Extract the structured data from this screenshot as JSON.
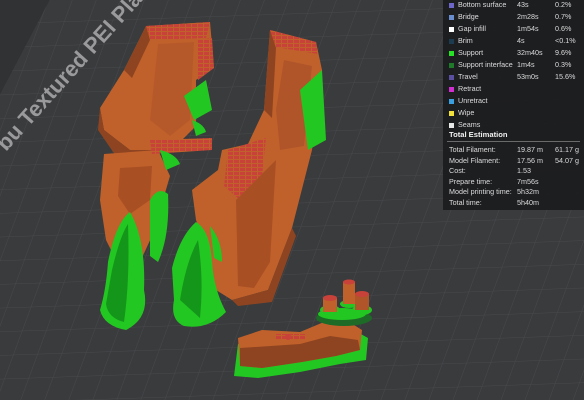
{
  "plate": {
    "label": "bu Textured PEI Plate"
  },
  "colors": {
    "bg": "#2b2c2e",
    "bed": "#3a3b3d",
    "model": "#c0612b",
    "model_dark": "#8e4420",
    "model_light": "#d8783c",
    "support": "#22c722",
    "support_dark": "#14961a",
    "infill_red": "#c8423a"
  },
  "legend": {
    "rows": [
      {
        "label": "Bottom surface",
        "time": "43s",
        "pct": "0.2%",
        "color": "#6e67c9"
      },
      {
        "label": "Bridge",
        "time": "2m28s",
        "pct": "0.7%",
        "color": "#6a8dcf"
      },
      {
        "label": "Gap infill",
        "time": "1m54s",
        "pct": "0.6%",
        "color": "#ffffff"
      },
      {
        "label": "Brim",
        "time": "4s",
        "pct": "<0.1%",
        "color": "#1c3b4e"
      },
      {
        "label": "Support",
        "time": "32m40s",
        "pct": "9.6%",
        "color": "#26e326"
      },
      {
        "label": "Support interface",
        "time": "1m4s",
        "pct": "0.3%",
        "color": "#1f7a2a"
      },
      {
        "label": "Travel",
        "time": "53m0s",
        "pct": "15.6%",
        "color": "#5a4fa0"
      },
      {
        "label": "Retract",
        "time": "",
        "pct": "",
        "color": "#d22ed2"
      },
      {
        "label": "Unretract",
        "time": "",
        "pct": "",
        "color": "#3aa0e0"
      },
      {
        "label": "Wipe",
        "time": "",
        "pct": "",
        "color": "#f2e23a"
      },
      {
        "label": "Seams",
        "time": "",
        "pct": "",
        "color": "#e8e8e8"
      }
    ]
  },
  "estimation": {
    "title": "Total Estimation",
    "rows": [
      {
        "label": "Total Filament:",
        "v1": "19.87 m",
        "v2": "61.17 g"
      },
      {
        "label": "Model Filament:",
        "v1": "17.56 m",
        "v2": "54.07 g"
      },
      {
        "label": "Cost:",
        "v1": "1.53",
        "v2": ""
      },
      {
        "label": "Prepare time:",
        "v1": "7m56s",
        "v2": ""
      },
      {
        "label": "Model printing time:",
        "v1": "5h32m",
        "v2": ""
      },
      {
        "label": "Total time:",
        "v1": "5h40m",
        "v2": ""
      }
    ]
  }
}
